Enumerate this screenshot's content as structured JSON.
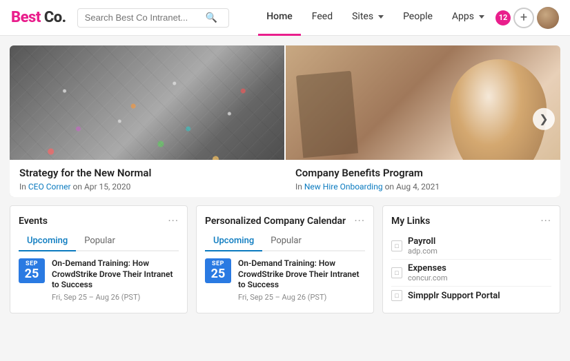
{
  "header": {
    "logo_best": "Best",
    "logo_co": "Co.",
    "search_placeholder": "Search Best Co Intranet...",
    "nav": [
      {
        "label": "Home",
        "active": true,
        "has_dropdown": false
      },
      {
        "label": "Feed",
        "active": false,
        "has_dropdown": false
      },
      {
        "label": "Sites",
        "active": false,
        "has_dropdown": true
      },
      {
        "label": "People",
        "active": false,
        "has_dropdown": false
      },
      {
        "label": "Apps",
        "active": false,
        "has_dropdown": true
      }
    ],
    "notification_count": "12",
    "add_btn_label": "+",
    "more_icon": "···"
  },
  "hero": {
    "nav_next_label": "❯",
    "cards": [
      {
        "title": "Strategy for the New Normal",
        "meta_prefix": "In",
        "category": "CEO Corner",
        "meta_suffix": "on Apr 15, 2020"
      },
      {
        "title": "Company Benefits Program",
        "meta_prefix": "In",
        "category": "New Hire Onboarding",
        "meta_suffix": "on Aug 4, 2021"
      }
    ]
  },
  "events_card": {
    "title": "Events",
    "more_icon": "···",
    "tabs": [
      {
        "label": "Upcoming",
        "active": true
      },
      {
        "label": "Popular",
        "active": false
      }
    ],
    "items": [
      {
        "month": "SEP",
        "day": "25",
        "title": "On-Demand Training: How CrowdStrike Drove Their Intranet to Success",
        "time": "Fri, Sep 25 – Aug 26 (PST)"
      }
    ]
  },
  "calendar_card": {
    "title": "Personalized Company Calendar",
    "more_icon": "···",
    "tabs": [
      {
        "label": "Upcoming",
        "active": true
      },
      {
        "label": "Popular",
        "active": false
      }
    ],
    "items": [
      {
        "month": "SEP",
        "day": "25",
        "title": "On-Demand Training: How CrowdStrike Drove Their Intranet to Success",
        "time": "Fri, Sep 25 – Aug 26 (PST)"
      }
    ]
  },
  "links_card": {
    "title": "My Links",
    "more_icon": "···",
    "links": [
      {
        "label": "Payroll",
        "url": "adp.com"
      },
      {
        "label": "Expenses",
        "url": "concur.com"
      },
      {
        "label": "Simpplr Support Portal",
        "url": ""
      }
    ]
  }
}
